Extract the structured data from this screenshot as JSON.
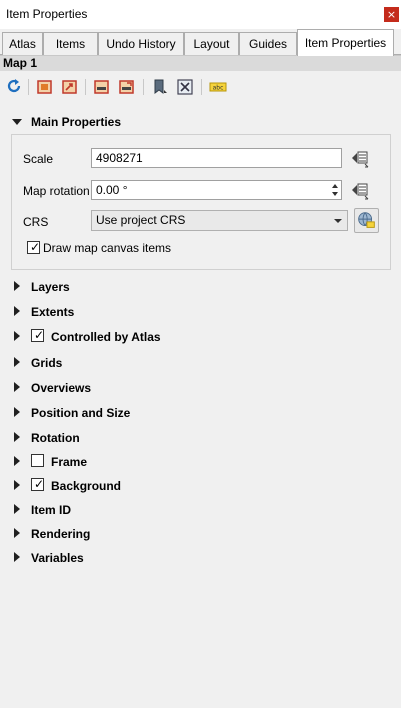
{
  "window": {
    "title": "Item Properties",
    "close_symbol": "×"
  },
  "tabs": [
    {
      "label": "Atlas",
      "active": false
    },
    {
      "label": "Items",
      "active": false
    },
    {
      "label": "Undo History",
      "active": false
    },
    {
      "label": "Layout",
      "active": false
    },
    {
      "label": "Guides",
      "active": false
    },
    {
      "label": "Item Properties",
      "active": true
    }
  ],
  "item_name": "Map 1",
  "toolbar": {
    "buttons": [
      "refresh-icon",
      "set-extent-to-canvas-icon",
      "view-extent-in-canvas-icon",
      "set-scale-from-canvas-icon",
      "set-canvas-scale-icon",
      "bookmarks-icon",
      "interactively-edit-extent-icon",
      "label-settings-icon"
    ]
  },
  "main_properties": {
    "title": "Main Properties",
    "scale_label": "Scale",
    "scale_value": "4908271",
    "rotation_label": "Map rotation",
    "rotation_value": "0.00 °",
    "crs_label": "CRS",
    "crs_value": "Use project CRS",
    "draw_canvas_items_label": "Draw map canvas items",
    "draw_canvas_items_checked": true
  },
  "sections": [
    {
      "label": "Layers",
      "checkbox": null
    },
    {
      "label": "Extents",
      "checkbox": null
    },
    {
      "label": "Controlled by Atlas",
      "checkbox": true
    },
    {
      "label": "Grids",
      "checkbox": null
    },
    {
      "label": "Overviews",
      "checkbox": null
    },
    {
      "label": "Position and Size",
      "checkbox": null
    },
    {
      "label": "Rotation",
      "checkbox": null
    },
    {
      "label": "Frame",
      "checkbox": false
    },
    {
      "label": "Background",
      "checkbox": true
    },
    {
      "label": "Item ID",
      "checkbox": null
    },
    {
      "label": "Rendering",
      "checkbox": null
    },
    {
      "label": "Variables",
      "checkbox": null
    }
  ],
  "checkmark_symbol": "✓",
  "colors": {
    "close_button": "#c42b1c",
    "panel_bg": "#f0f0f0",
    "header_strip": "#dadada"
  }
}
